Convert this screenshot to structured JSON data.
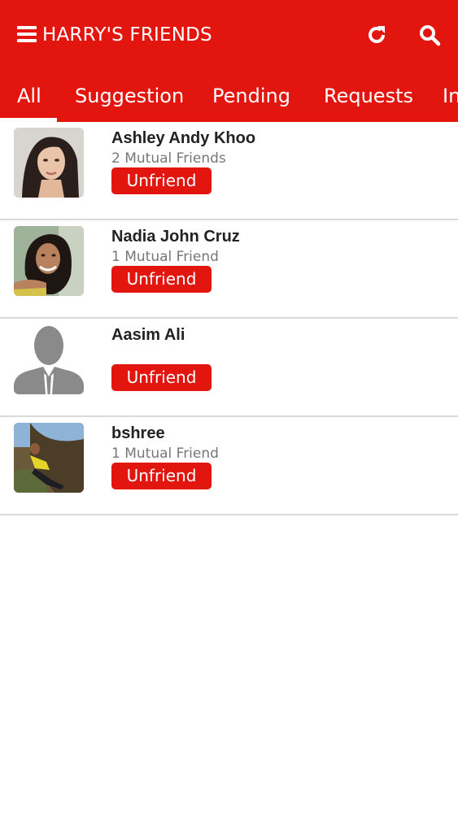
{
  "header": {
    "title": "HARRY'S FRIENDS",
    "icons": {
      "menu": "hamburger-menu-icon",
      "refresh": "refresh-icon",
      "search": "search-icon"
    },
    "accent_color": "#e3160f"
  },
  "tabs": [
    {
      "label": "All",
      "selected": true
    },
    {
      "label": "Suggestion",
      "selected": false
    },
    {
      "label": "Pending",
      "selected": false
    },
    {
      "label": "Requests",
      "selected": false
    },
    {
      "label": "In",
      "selected": false
    }
  ],
  "friends": [
    {
      "name": "Ashley Andy Khoo",
      "mutual": "2 Mutual Friends",
      "action": "Unfriend",
      "avatar": "photo-woman-dark-hair"
    },
    {
      "name": "Nadia John Cruz",
      "mutual": "1 Mutual Friend",
      "action": "Unfriend",
      "avatar": "photo-woman-smiling"
    },
    {
      "name": "Aasim Ali",
      "mutual": "",
      "action": "Unfriend",
      "avatar": "default-silhouette-icon"
    },
    {
      "name": "bshree",
      "mutual": "1 Mutual Friend",
      "action": "Unfriend",
      "avatar": "photo-outdoor-person"
    }
  ]
}
